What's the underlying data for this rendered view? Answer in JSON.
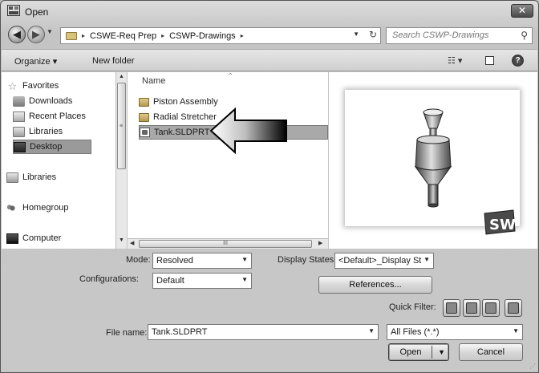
{
  "window": {
    "title": "Open",
    "close_glyph": "✕"
  },
  "address": {
    "crumbs": [
      "CSWE-Req Prep",
      "CSWP-Drawings"
    ],
    "separator": "▸",
    "search_placeholder": "Search CSWP-Drawings"
  },
  "toolbar": {
    "organize": "Organize ▾",
    "new_folder": "New folder",
    "views": "☷ ▾",
    "help": "?"
  },
  "navpane": {
    "items": [
      {
        "label": "Favorites",
        "icon": "star-icon"
      },
      {
        "label": "Downloads",
        "icon": "downloads-icon"
      },
      {
        "label": "Recent Places",
        "icon": "recent-places-icon"
      },
      {
        "label": "Libraries",
        "icon": "libraries-icon"
      },
      {
        "label": "Desktop",
        "icon": "desktop-icon",
        "selected": true
      },
      {
        "label": "Libraries",
        "icon": "libraries-icon"
      },
      {
        "label": "Homegroup",
        "icon": "homegroup-icon"
      },
      {
        "label": "Computer",
        "icon": "computer-icon"
      }
    ]
  },
  "filelist": {
    "column_name": "Name",
    "files": [
      {
        "name": "Piston Assembly",
        "icon": "folder-icon"
      },
      {
        "name": "Radial Stretcher",
        "icon": "folder-icon"
      },
      {
        "name": "Tank.SLDPRT",
        "icon": "part-file-icon",
        "selected": true
      }
    ],
    "hscroll_grip": "III"
  },
  "preview": {
    "logo_text": "SW",
    "brand_color": "#4a4a4a"
  },
  "form": {
    "mode_label": "Mode:",
    "mode_value": "Resolved",
    "configurations_label": "Configurations:",
    "configurations_value": "Default",
    "display_states_label": "Display States:",
    "display_states_value": "<Default>_Display St",
    "references_button": "References...",
    "quick_filter_label": "Quick Filter:",
    "file_name_label": "File name:",
    "file_name_value": "Tank.SLDPRT",
    "file_type_value": "All Files (*.*)",
    "open_button": "Open",
    "cancel_button": "Cancel"
  }
}
